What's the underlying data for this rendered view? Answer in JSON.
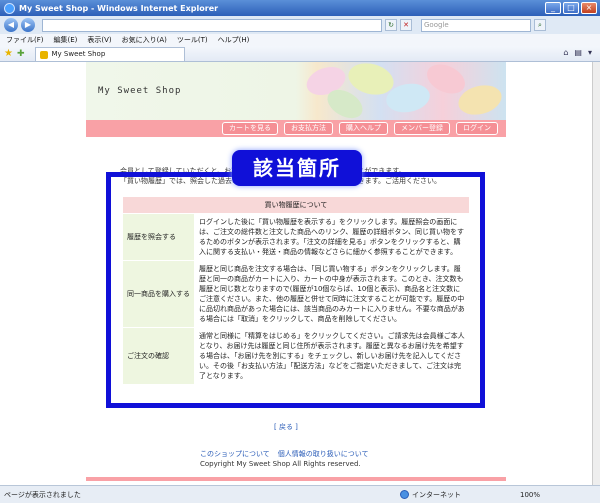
{
  "window": {
    "title": "My Sweet Shop - Windows Internet Explorer",
    "min": "_",
    "max": "□",
    "close": "×"
  },
  "addressbar": {
    "back": "◀",
    "forward": "▶",
    "refresh": "↻",
    "stop": "✕",
    "search_placeholder": "Google"
  },
  "menu": [
    "ファイル(F)",
    "編集(E)",
    "表示(V)",
    "お気に入り(A)",
    "ツール(T)",
    "ヘルプ(H)"
  ],
  "tab": {
    "label": "My Sweet Shop"
  },
  "site": {
    "title": "My Sweet Shop",
    "nav": [
      "カートを見る",
      "お支払方法",
      "購入ヘルプ",
      "メンバー登録",
      "ログイン"
    ]
  },
  "intro": {
    "line1": "会員として登録していただくと、お客様の過去のご注文の履歴を閲覧することができます。",
    "line2": "「買い物履歴」では、照会した過去の注文の商品を、再度購入することもできます。ご活用ください。"
  },
  "callout": "該当箇所",
  "table": {
    "header": "買い物履歴について",
    "rows": [
      {
        "label": "履歴を照会する",
        "desc": "ログインした後に「買い物履歴を表示する」をクリックします。履歴照会の画面には、ご注文の総件数と注文した商品へのリンク、履歴の詳細ボタン、同じ買い物をするためのボタンが表示されます。「注文の詳細を見る」ボタンをクリックすると、購入に関する支払い・発送・商品の情報などさらに細かく参照することができます。"
      },
      {
        "label": "同一商品を購入する",
        "desc": "履歴と同じ商品を注文する場合は、「同じ買い物する」ボタンをクリックします。履歴と同一の商品がカートに入り、カートの中身が表示されます。このとき、注文数も履歴と同じ数となりますので(履歴が10個ならば、10個と表示)、商品名と注文数にご注意ください。また、他の履歴と併せて同時に注文することが可能です。履歴の中に品切れ商品があった場合には、該当商品のみカートに入りません。不要な商品がある場合には「取消」をクリックして、商品を削除してください。"
      },
      {
        "label": "ご注文の確認",
        "desc": "通常と同様に「精算をはじめる」をクリックしてください。ご請求先は会員様ご本人となり、お届け先は履歴と同じ住所が表示されます。履歴と異なるお届け先を希望する場合は、「お届け先を別にする」をチェックし、新しいお届け先を記入してください。その後「お支払い方法」「配送方法」などをご指定いただきまして、ご注文は完了となります。"
      }
    ]
  },
  "back": "[ 戻る ]",
  "footer": {
    "link1": "このショップについて",
    "link2": "個人情報の取り扱いについて",
    "copyright": "Copyright My Sweet Shop All Rights reserved."
  },
  "status": {
    "text": "ページが表示されました",
    "zone": "インターネット",
    "zoom": "100%"
  }
}
